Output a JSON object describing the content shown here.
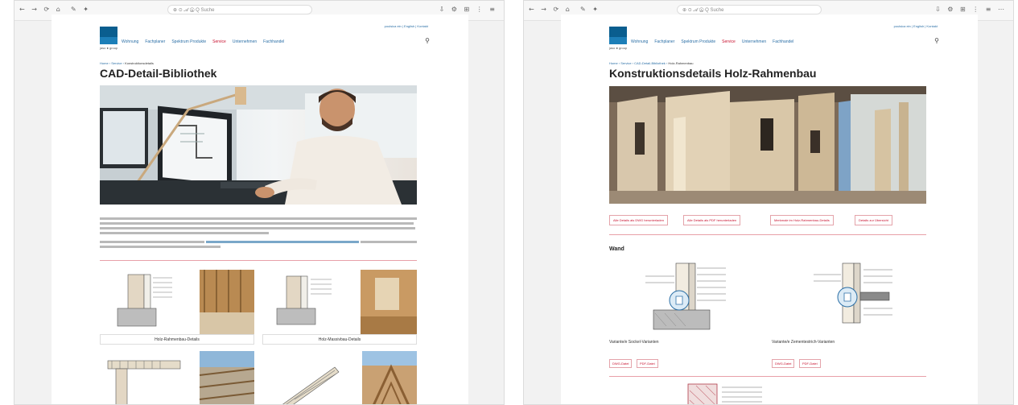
{
  "left": {
    "browser": {
      "nav": "← → ⟳ ⌂",
      "tab_icons": "✎ ✦",
      "url": "⊕ ⊙ 𝓐 Ⓐ  Q Suche",
      "tools": "⇩ ⚙ ⊞ ⋮ ≡"
    },
    "site": {
      "toplinks": "poulsica ein | English | Kontakt",
      "logo_text": "jaso ● group",
      "nav": [
        "Wohnung",
        "Fachplaner",
        "Spektrum Produkte",
        "Service",
        "Unternehmen",
        "Fachhandel"
      ],
      "active_nav": "Service"
    },
    "breadcrumb": "Home › Service › ",
    "breadcrumb_current": "Konstruktionsdetails",
    "title": "CAD-Detail-Bibliothek",
    "tiles": [
      {
        "caption": "Holz-Rahmenbau-Details"
      },
      {
        "caption": "Holz-Massivbau-Details"
      }
    ]
  },
  "right": {
    "browser": {
      "nav": "← → ⟳ ⌂",
      "tab_icons": "✎ ✦",
      "url": "⊕ ⊙ 𝓐 Ⓐ  Q Suche",
      "tools": "⇩ ⚙ ⊞ ⋮ ≡ ⋯"
    },
    "site": {
      "toplinks": "poulsica ein | English | Kontakt",
      "logo_text": "jaso ● group",
      "nav": [
        "Wohnung",
        "Fachplaner",
        "Spektrum Produkte",
        "Service",
        "Unternehmen",
        "Fachhandel"
      ],
      "active_nav": "Service"
    },
    "breadcrumb": "Home › Service › CAD-Detail-Bibliothek › ",
    "breadcrumb_current": "Holz-Rahmenbau",
    "title": "Konstruktionsdetails Holz-Rahmenbau",
    "buttons": [
      "Alle Details als DWG herunterladen",
      "Alle Details als PDF herunterladen",
      "Merkmale im Holz-Rahmenbau-Details",
      "Details zur Übersicht"
    ],
    "section": "Wand",
    "details": [
      {
        "title": "Variante/e Sockel-Varianten",
        "buttons": [
          "DWG-Datei",
          "PDF-Datei"
        ]
      },
      {
        "title": "Variante/e Zementestrich-Varianten",
        "buttons": [
          "DWG-Datei",
          "PDF-Datei"
        ]
      }
    ]
  }
}
